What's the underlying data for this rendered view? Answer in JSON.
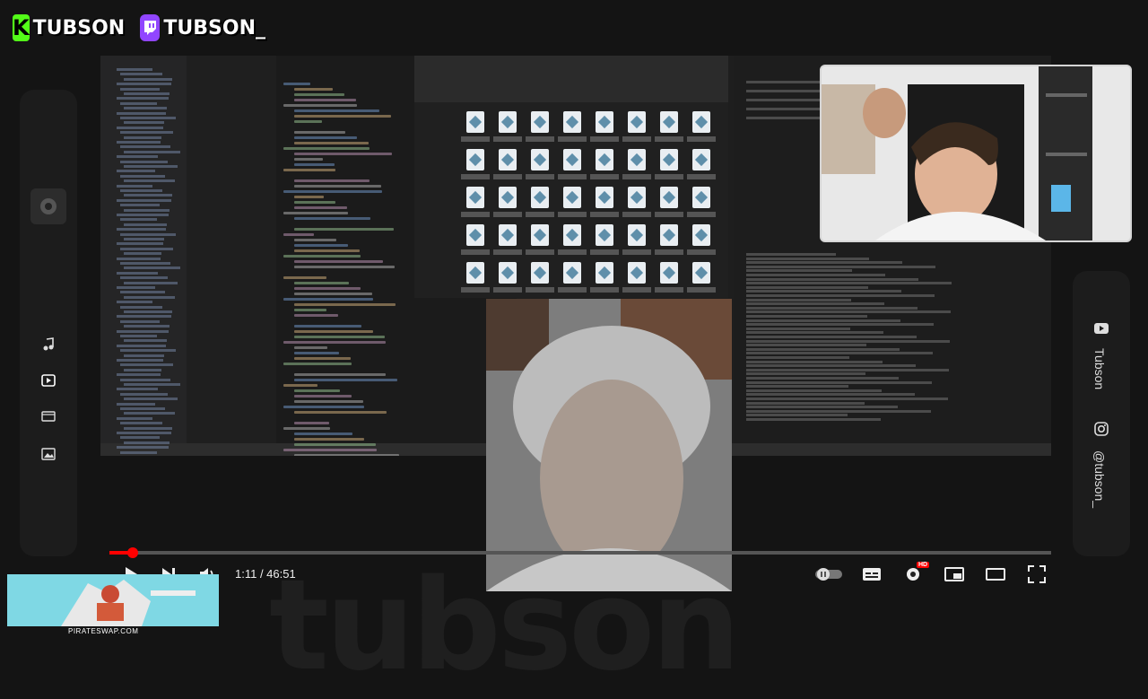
{
  "overlay": {
    "kick_name": "TUBSON",
    "twitch_name": "TUBSON_",
    "channel_vertical": "Tubson",
    "instagram_handle": "@tubson_",
    "watermark": "tubson",
    "ad_url": "PIRATESWAP.COM"
  },
  "player": {
    "time_display": "1:11 / 46:51",
    "progress_fraction": 0.025,
    "hd_badge": "HD"
  },
  "colors": {
    "kick_green": "#53fc18",
    "twitch_purple": "#9146ff",
    "progress_red": "#ff0000"
  },
  "icons": {
    "left_rail": [
      "music-note-icon",
      "play-video-icon",
      "film-icon",
      "image-icon"
    ],
    "right_rail": [
      "youtube-icon",
      "instagram-icon"
    ],
    "controls": [
      "play-icon",
      "next-icon",
      "volume-icon",
      "autoplay-toggle-icon",
      "subtitles-icon",
      "settings-icon",
      "miniplayer-icon",
      "theater-mode-icon",
      "fullscreen-icon"
    ]
  }
}
